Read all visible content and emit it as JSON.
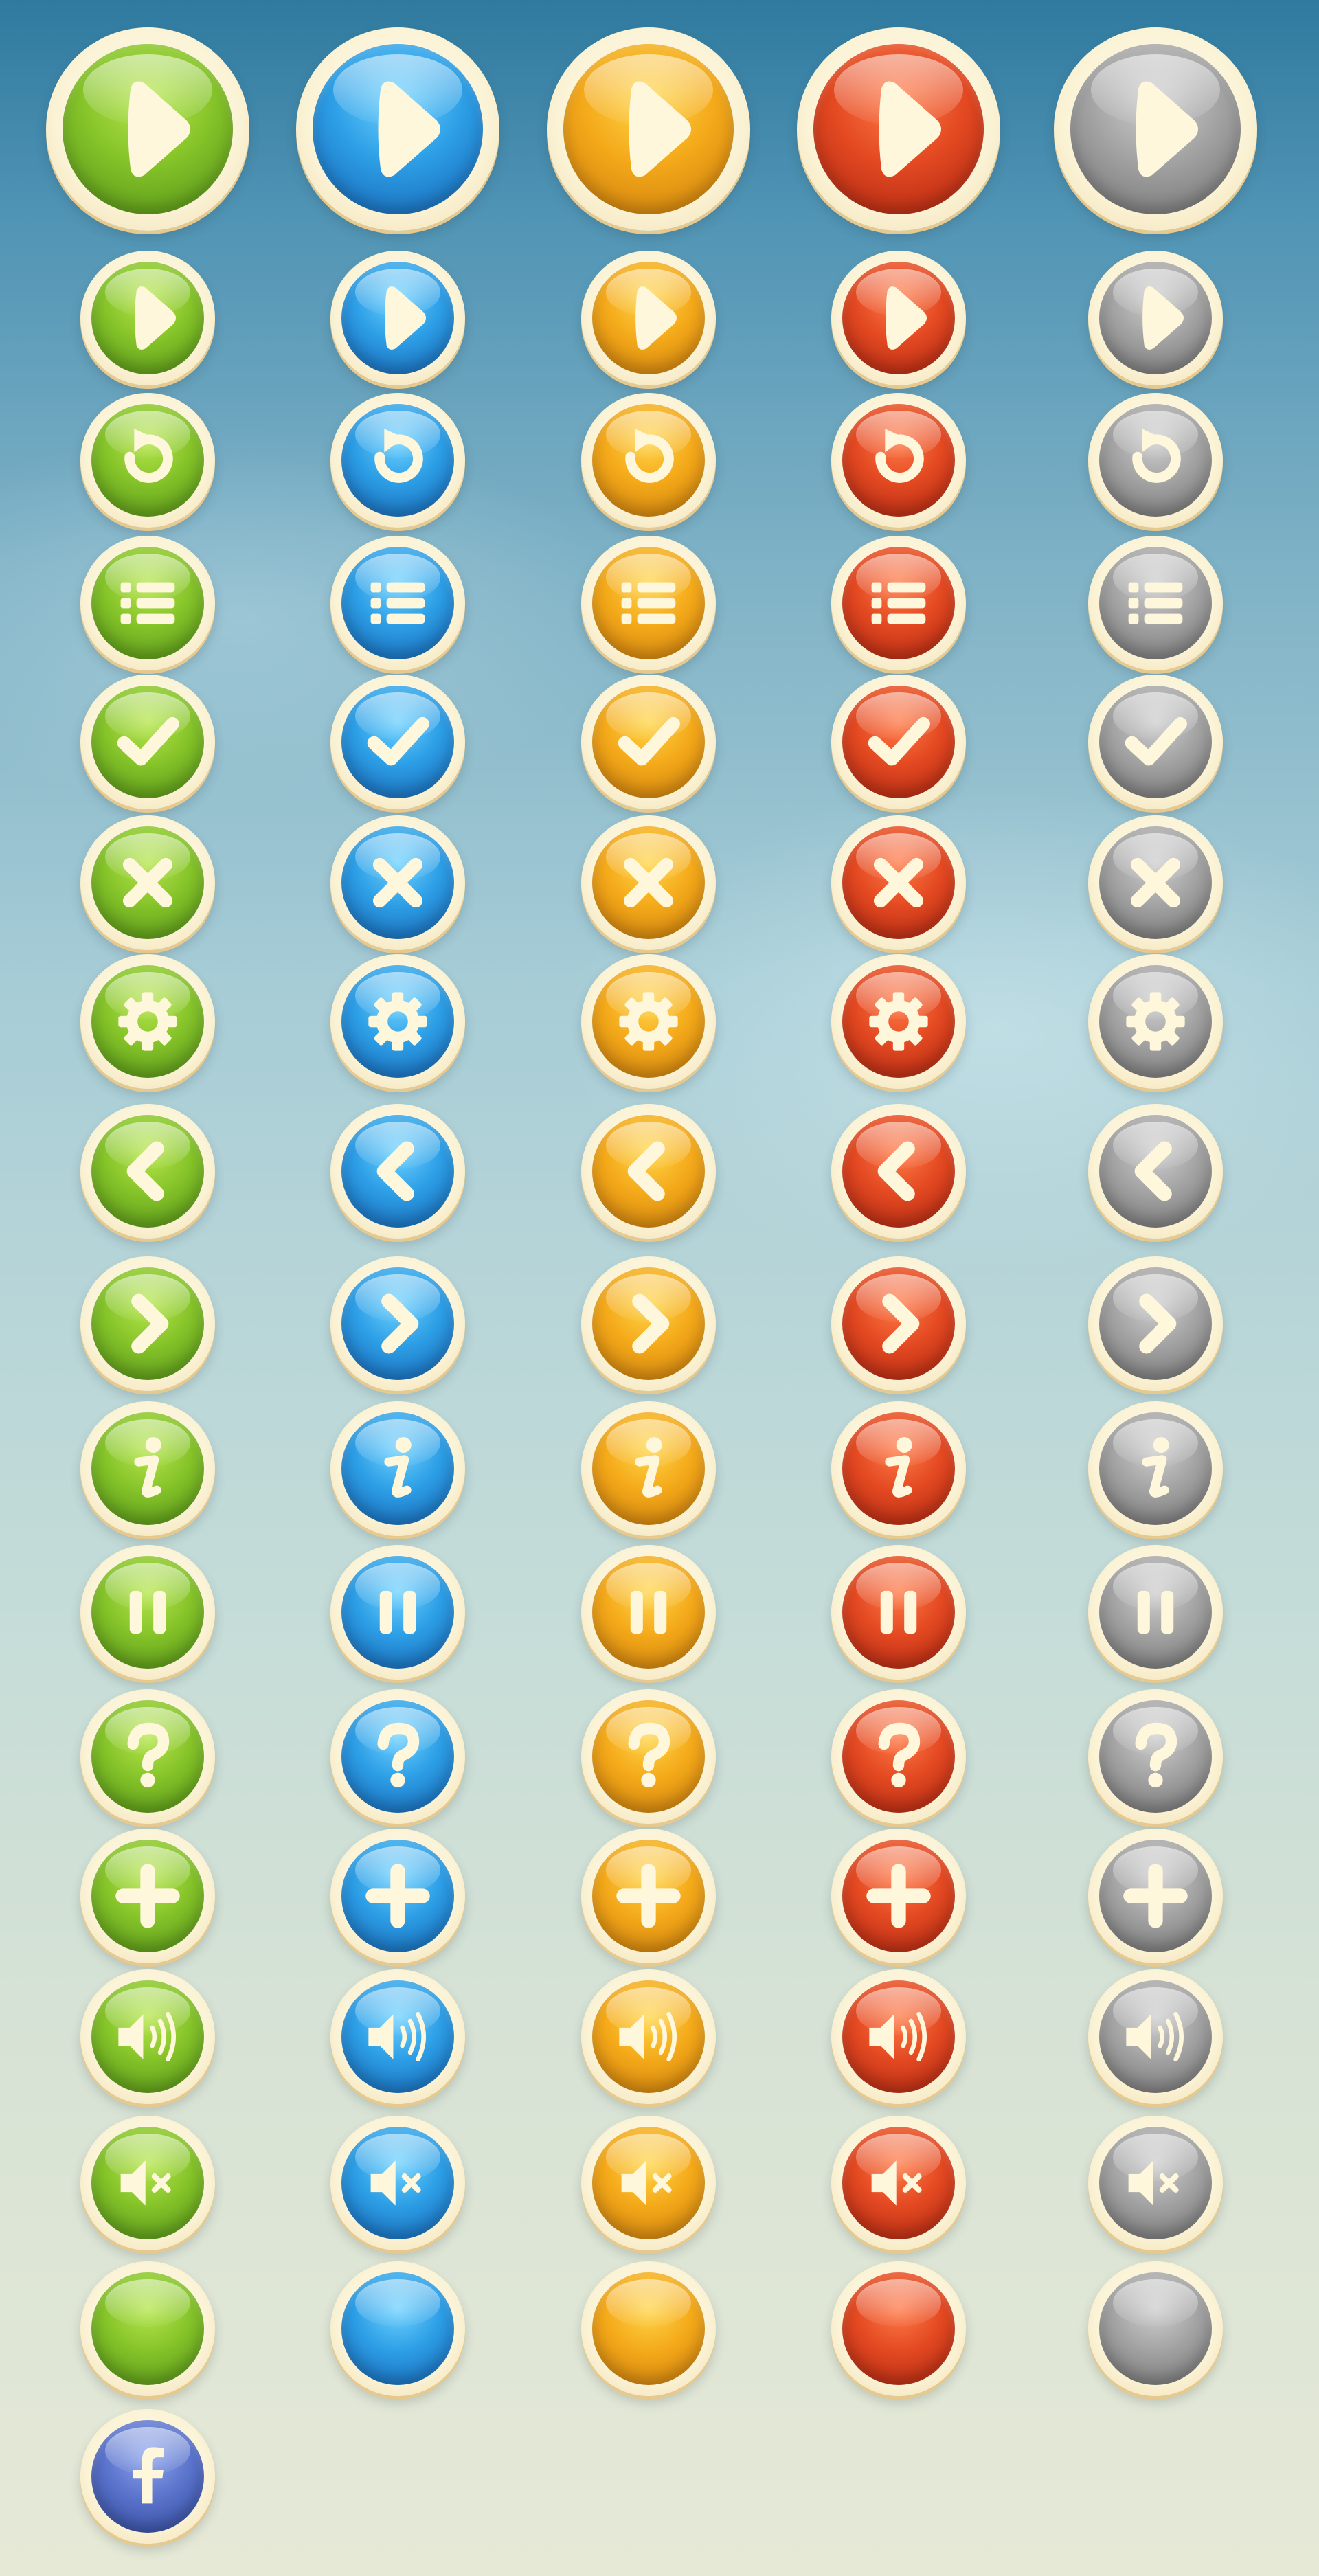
{
  "palette": {
    "green": "#86c42a",
    "blue": "#2d9fe6",
    "yellow": "#f4aa1a",
    "red": "#e44a22",
    "gray": "#a3a3a3",
    "facebook": "#5b74cc",
    "rim": "#fbf3d6",
    "glyph": "#fff7dc"
  },
  "colors": [
    "green",
    "blue",
    "yellow",
    "red",
    "gray"
  ],
  "rows": [
    "play-large",
    "play",
    "replay",
    "list",
    "check",
    "close",
    "settings",
    "arrow-left",
    "arrow-right",
    "info",
    "pause",
    "help",
    "plus",
    "sound-on",
    "sound-off",
    "blank"
  ],
  "extra_buttons": [
    {
      "icon": "facebook",
      "color": "facebook"
    }
  ]
}
